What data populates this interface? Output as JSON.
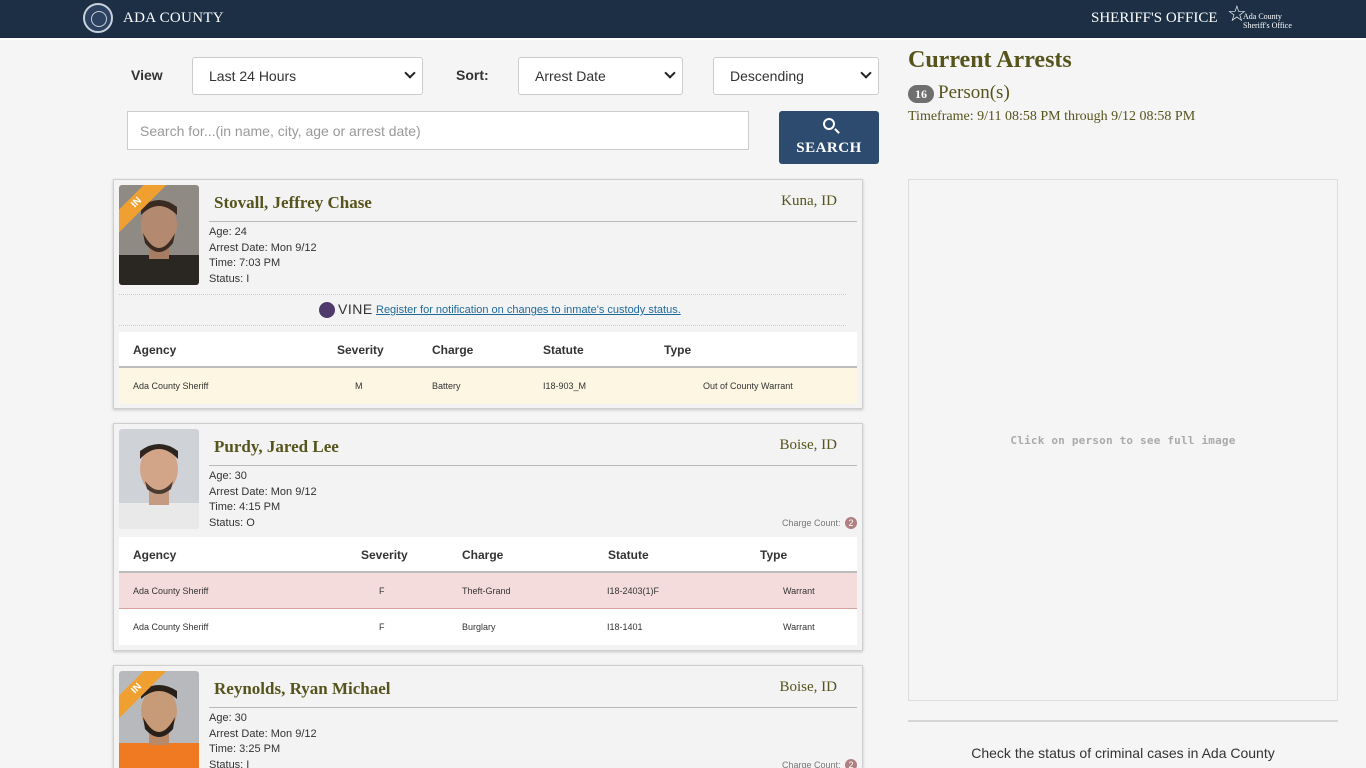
{
  "header": {
    "brand": "ADA COUNTY",
    "office": "SHERIFF'S OFFICE",
    "logo_line1": "Ada County",
    "logo_line2": "Sheriff's Office"
  },
  "filters": {
    "view_label": "View",
    "view_value": "Last 24 Hours",
    "sort_label": "Sort:",
    "sort_value": "Arrest Date",
    "order_value": "Descending",
    "search_placeholder": "Search for...(in name, city, age or arrest date)",
    "search_button": "SEARCH"
  },
  "summary": {
    "title": "Current Arrests",
    "count": "16",
    "count_label": "Person(s)",
    "timeframe": "Timeframe: 9/11 08:58 PM through 9/12 08:58 PM",
    "viewer_hint": "Click on person to see full image",
    "cases_text": "Check the status of criminal cases in Ada County"
  },
  "table_headers": {
    "agency": "Agency",
    "severity": "Severity",
    "charge": "Charge",
    "statute": "Statute",
    "type": "Type"
  },
  "vine": {
    "brand": "VINE",
    "link": " Register for notification on changes to inmate's custody status."
  },
  "persons": [
    {
      "name": "Stovall, Jeffrey Chase",
      "city": "Kuna, ID",
      "ribbon": "IN",
      "age": "Age: 24",
      "arrest_date": "Arrest Date: Mon 9/12",
      "time": "Time: 7:03 PM",
      "status": "Status: I",
      "charges": [
        {
          "agency": "Ada County Sheriff",
          "severity": "M",
          "charge": "Battery",
          "statute": "I18-903_M",
          "type": "Out of County Warrant"
        }
      ]
    },
    {
      "name": "Purdy, Jared Lee",
      "city": "Boise, ID",
      "age": "Age: 30",
      "arrest_date": "Arrest Date: Mon 9/12",
      "time": "Time: 4:15 PM",
      "status": "Status: O",
      "charge_count_label": "Charge Count:",
      "charge_count": "2",
      "charges": [
        {
          "agency": "Ada County Sheriff",
          "severity": "F",
          "charge": "Theft-Grand",
          "statute": "I18-2403(1)F",
          "type": "Warrant"
        },
        {
          "agency": "Ada County Sheriff",
          "severity": "F",
          "charge": "Burglary",
          "statute": "I18-1401",
          "type": "Warrant"
        }
      ]
    },
    {
      "name": "Reynolds, Ryan Michael",
      "city": "Boise, ID",
      "ribbon": "IN",
      "age": "Age: 30",
      "arrest_date": "Arrest Date: Mon 9/12",
      "time": "Time: 3:25 PM",
      "status": "Status: I",
      "charge_count_label": "Charge Count:",
      "charge_count": "2"
    }
  ]
}
